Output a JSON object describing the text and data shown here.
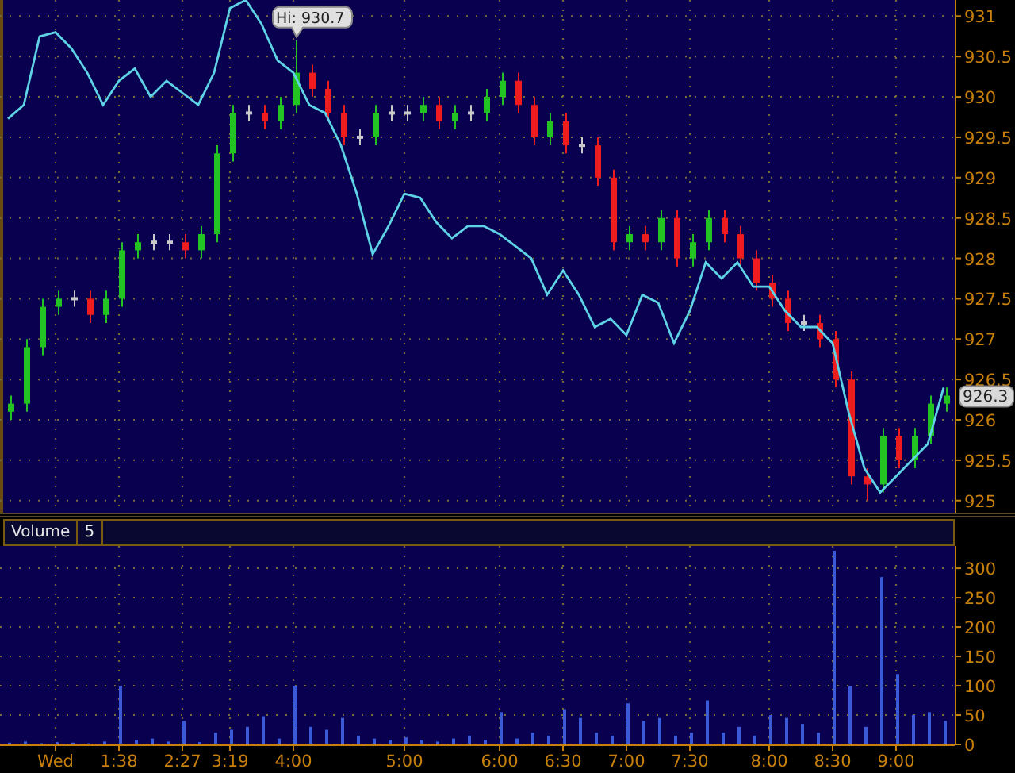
{
  "price_chart": {
    "last_price_tag": "926.3",
    "chart_data": {
      "type": "candlestick",
      "grid": true,
      "ylim": [
        924.85,
        931.2
      ],
      "yticks": [
        925,
        925.5,
        926,
        926.5,
        927,
        927.5,
        928,
        928.5,
        929,
        929.5,
        930,
        930.5,
        931
      ],
      "ohlc": [
        [
          926.1,
          926.3,
          926.0,
          926.2
        ],
        [
          926.2,
          927.0,
          926.1,
          926.9
        ],
        [
          926.9,
          927.5,
          926.8,
          927.4
        ],
        [
          927.4,
          927.6,
          927.3,
          927.5
        ],
        [
          927.5,
          927.6,
          927.4,
          927.5
        ],
        [
          927.5,
          927.6,
          927.2,
          927.3
        ],
        [
          927.3,
          927.6,
          927.2,
          927.5
        ],
        [
          927.5,
          928.2,
          927.4,
          928.1
        ],
        [
          928.1,
          928.3,
          928.0,
          928.2
        ],
        [
          928.2,
          928.3,
          928.1,
          928.2
        ],
        [
          928.2,
          928.3,
          928.1,
          928.2
        ],
        [
          928.2,
          928.3,
          928.0,
          928.1
        ],
        [
          928.1,
          928.4,
          928.0,
          928.3
        ],
        [
          928.3,
          929.4,
          928.2,
          929.3
        ],
        [
          929.3,
          929.9,
          929.2,
          929.8
        ],
        [
          929.8,
          929.9,
          929.7,
          929.8
        ],
        [
          929.8,
          929.9,
          929.6,
          929.7
        ],
        [
          929.7,
          930.0,
          929.6,
          929.9
        ],
        [
          929.9,
          930.7,
          929.8,
          930.3
        ],
        [
          930.3,
          930.4,
          930.0,
          930.1
        ],
        [
          930.1,
          930.2,
          929.7,
          929.8
        ],
        [
          929.8,
          929.9,
          929.4,
          929.5
        ],
        [
          929.5,
          929.6,
          929.4,
          929.5
        ],
        [
          929.5,
          929.9,
          929.4,
          929.8
        ],
        [
          929.8,
          929.9,
          929.7,
          929.8
        ],
        [
          929.8,
          929.9,
          929.7,
          929.8
        ],
        [
          929.8,
          930.0,
          929.7,
          929.9
        ],
        [
          929.9,
          930.0,
          929.6,
          929.7
        ],
        [
          929.7,
          929.9,
          929.6,
          929.8
        ],
        [
          929.8,
          929.9,
          929.7,
          929.8
        ],
        [
          929.8,
          930.1,
          929.7,
          930.0
        ],
        [
          930.0,
          930.3,
          929.9,
          930.2
        ],
        [
          930.2,
          930.3,
          929.8,
          929.9
        ],
        [
          929.9,
          930.0,
          929.4,
          929.5
        ],
        [
          929.5,
          929.8,
          929.4,
          929.7
        ],
        [
          929.7,
          929.8,
          929.3,
          929.4
        ],
        [
          929.4,
          929.5,
          929.3,
          929.4
        ],
        [
          929.4,
          929.5,
          928.9,
          929.0
        ],
        [
          929.0,
          929.1,
          928.1,
          928.2
        ],
        [
          928.2,
          928.4,
          928.1,
          928.3
        ],
        [
          928.3,
          928.4,
          928.1,
          928.2
        ],
        [
          928.2,
          928.6,
          928.1,
          928.5
        ],
        [
          928.5,
          928.6,
          927.9,
          928.0
        ],
        [
          928.0,
          928.3,
          927.9,
          928.2
        ],
        [
          928.2,
          928.6,
          928.1,
          928.5
        ],
        [
          928.5,
          928.6,
          928.2,
          928.3
        ],
        [
          928.3,
          928.4,
          927.9,
          928.0
        ],
        [
          928.0,
          928.1,
          927.6,
          927.7
        ],
        [
          927.7,
          927.8,
          927.4,
          927.5
        ],
        [
          927.5,
          927.6,
          927.1,
          927.2
        ],
        [
          927.2,
          927.3,
          927.1,
          927.2
        ],
        [
          927.2,
          927.3,
          926.9,
          927.0
        ],
        [
          927.0,
          927.1,
          926.4,
          926.5
        ],
        [
          926.5,
          926.6,
          925.2,
          925.3
        ],
        [
          925.3,
          925.4,
          925.0,
          925.2
        ],
        [
          925.2,
          925.9,
          925.1,
          925.8
        ],
        [
          925.8,
          925.9,
          925.4,
          925.5
        ],
        [
          925.5,
          925.9,
          925.4,
          925.8
        ],
        [
          925.8,
          926.3,
          925.7,
          926.2
        ],
        [
          926.2,
          926.4,
          926.1,
          926.3
        ]
      ],
      "series": [
        {
          "type": "line",
          "color": "#5fd3e6",
          "values": [
            929.73,
            929.9,
            930.75,
            930.8,
            930.6,
            930.3,
            929.9,
            930.2,
            930.35,
            930.0,
            930.2,
            930.05,
            929.9,
            930.3,
            931.1,
            931.2,
            930.9,
            930.45,
            930.3,
            929.9,
            929.8,
            929.4,
            928.8,
            928.05,
            928.4,
            928.8,
            928.75,
            928.45,
            928.25,
            928.4,
            928.4,
            928.3,
            928.15,
            928.0,
            927.55,
            927.85,
            927.55,
            927.15,
            927.25,
            927.05,
            927.55,
            927.45,
            926.95,
            927.35,
            927.95,
            927.75,
            927.95,
            927.65,
            927.65,
            927.35,
            927.15,
            927.15,
            926.95,
            926.1,
            925.4,
            925.1,
            925.3,
            925.5,
            925.7,
            926.4
          ]
        }
      ],
      "annotations": [
        "Hi: 930.7"
      ]
    }
  },
  "volume_panel": {
    "title": "Volume",
    "interval": "5",
    "chart_data": {
      "type": "bar",
      "grid": true,
      "ylim": [
        0,
        338
      ],
      "yticks": [
        0,
        50,
        100,
        150,
        200,
        250,
        300
      ],
      "categories": [
        null,
        null,
        null,
        "Wed",
        null,
        null,
        null,
        "1:38",
        null,
        null,
        null,
        "2:27",
        null,
        null,
        "3:19",
        null,
        null,
        null,
        "4:00",
        null,
        null,
        null,
        null,
        null,
        null,
        "5:00",
        null,
        null,
        null,
        null,
        null,
        "6:00",
        null,
        null,
        null,
        "6:30",
        null,
        null,
        null,
        "7:00",
        null,
        null,
        null,
        "7:30",
        null,
        null,
        null,
        null,
        "8:00",
        null,
        null,
        null,
        "8:30",
        null,
        null,
        null,
        "9:00",
        null,
        null,
        null
      ],
      "series": [
        {
          "color": "#3a5ad8",
          "values": [
            3,
            5,
            2,
            4,
            3,
            2,
            5,
            100,
            8,
            10,
            5,
            40,
            4,
            20,
            25,
            30,
            48,
            10,
            100,
            30,
            25,
            45,
            15,
            10,
            8,
            12,
            8,
            5,
            10,
            15,
            8,
            55,
            10,
            20,
            15,
            60,
            45,
            20,
            15,
            70,
            40,
            45,
            15,
            20,
            75,
            20,
            30,
            15,
            50,
            45,
            35,
            20,
            330,
            100,
            30,
            285,
            120,
            50,
            55,
            40
          ]
        }
      ]
    }
  }
}
